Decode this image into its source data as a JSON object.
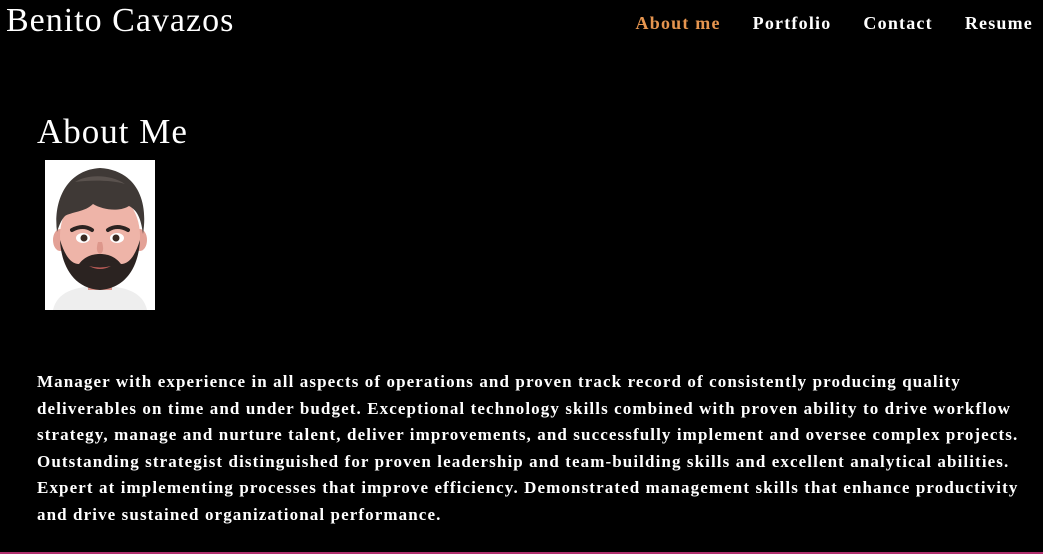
{
  "header": {
    "site_name": "Benito Cavazos",
    "nav": [
      {
        "label": "About me",
        "active": true
      },
      {
        "label": "Portfolio",
        "active": false
      },
      {
        "label": "Contact",
        "active": false
      },
      {
        "label": "Resume",
        "active": false
      }
    ]
  },
  "about": {
    "title": "About Me",
    "bio": "Manager with experience in all aspects of operations and proven track record of consistently producing quality deliverables on time and under budget. Exceptional technology skills combined with proven ability to drive workflow strategy, manage and nurture talent, deliver improvements, and successfully implement and oversee complex projects. Outstanding strategist distinguished for proven leadership and team-building skills and excellent analytical abilities. Expert at implementing processes that improve efficiency. Demonstrated management skills that enhance productivity and drive sustained organizational performance."
  },
  "colors": {
    "background": "#000000",
    "text": "#ffffff",
    "active_nav": "#e6954f",
    "bottom_rule": "#b0306e"
  },
  "icons": {
    "avatar": "memoji-avatar"
  }
}
